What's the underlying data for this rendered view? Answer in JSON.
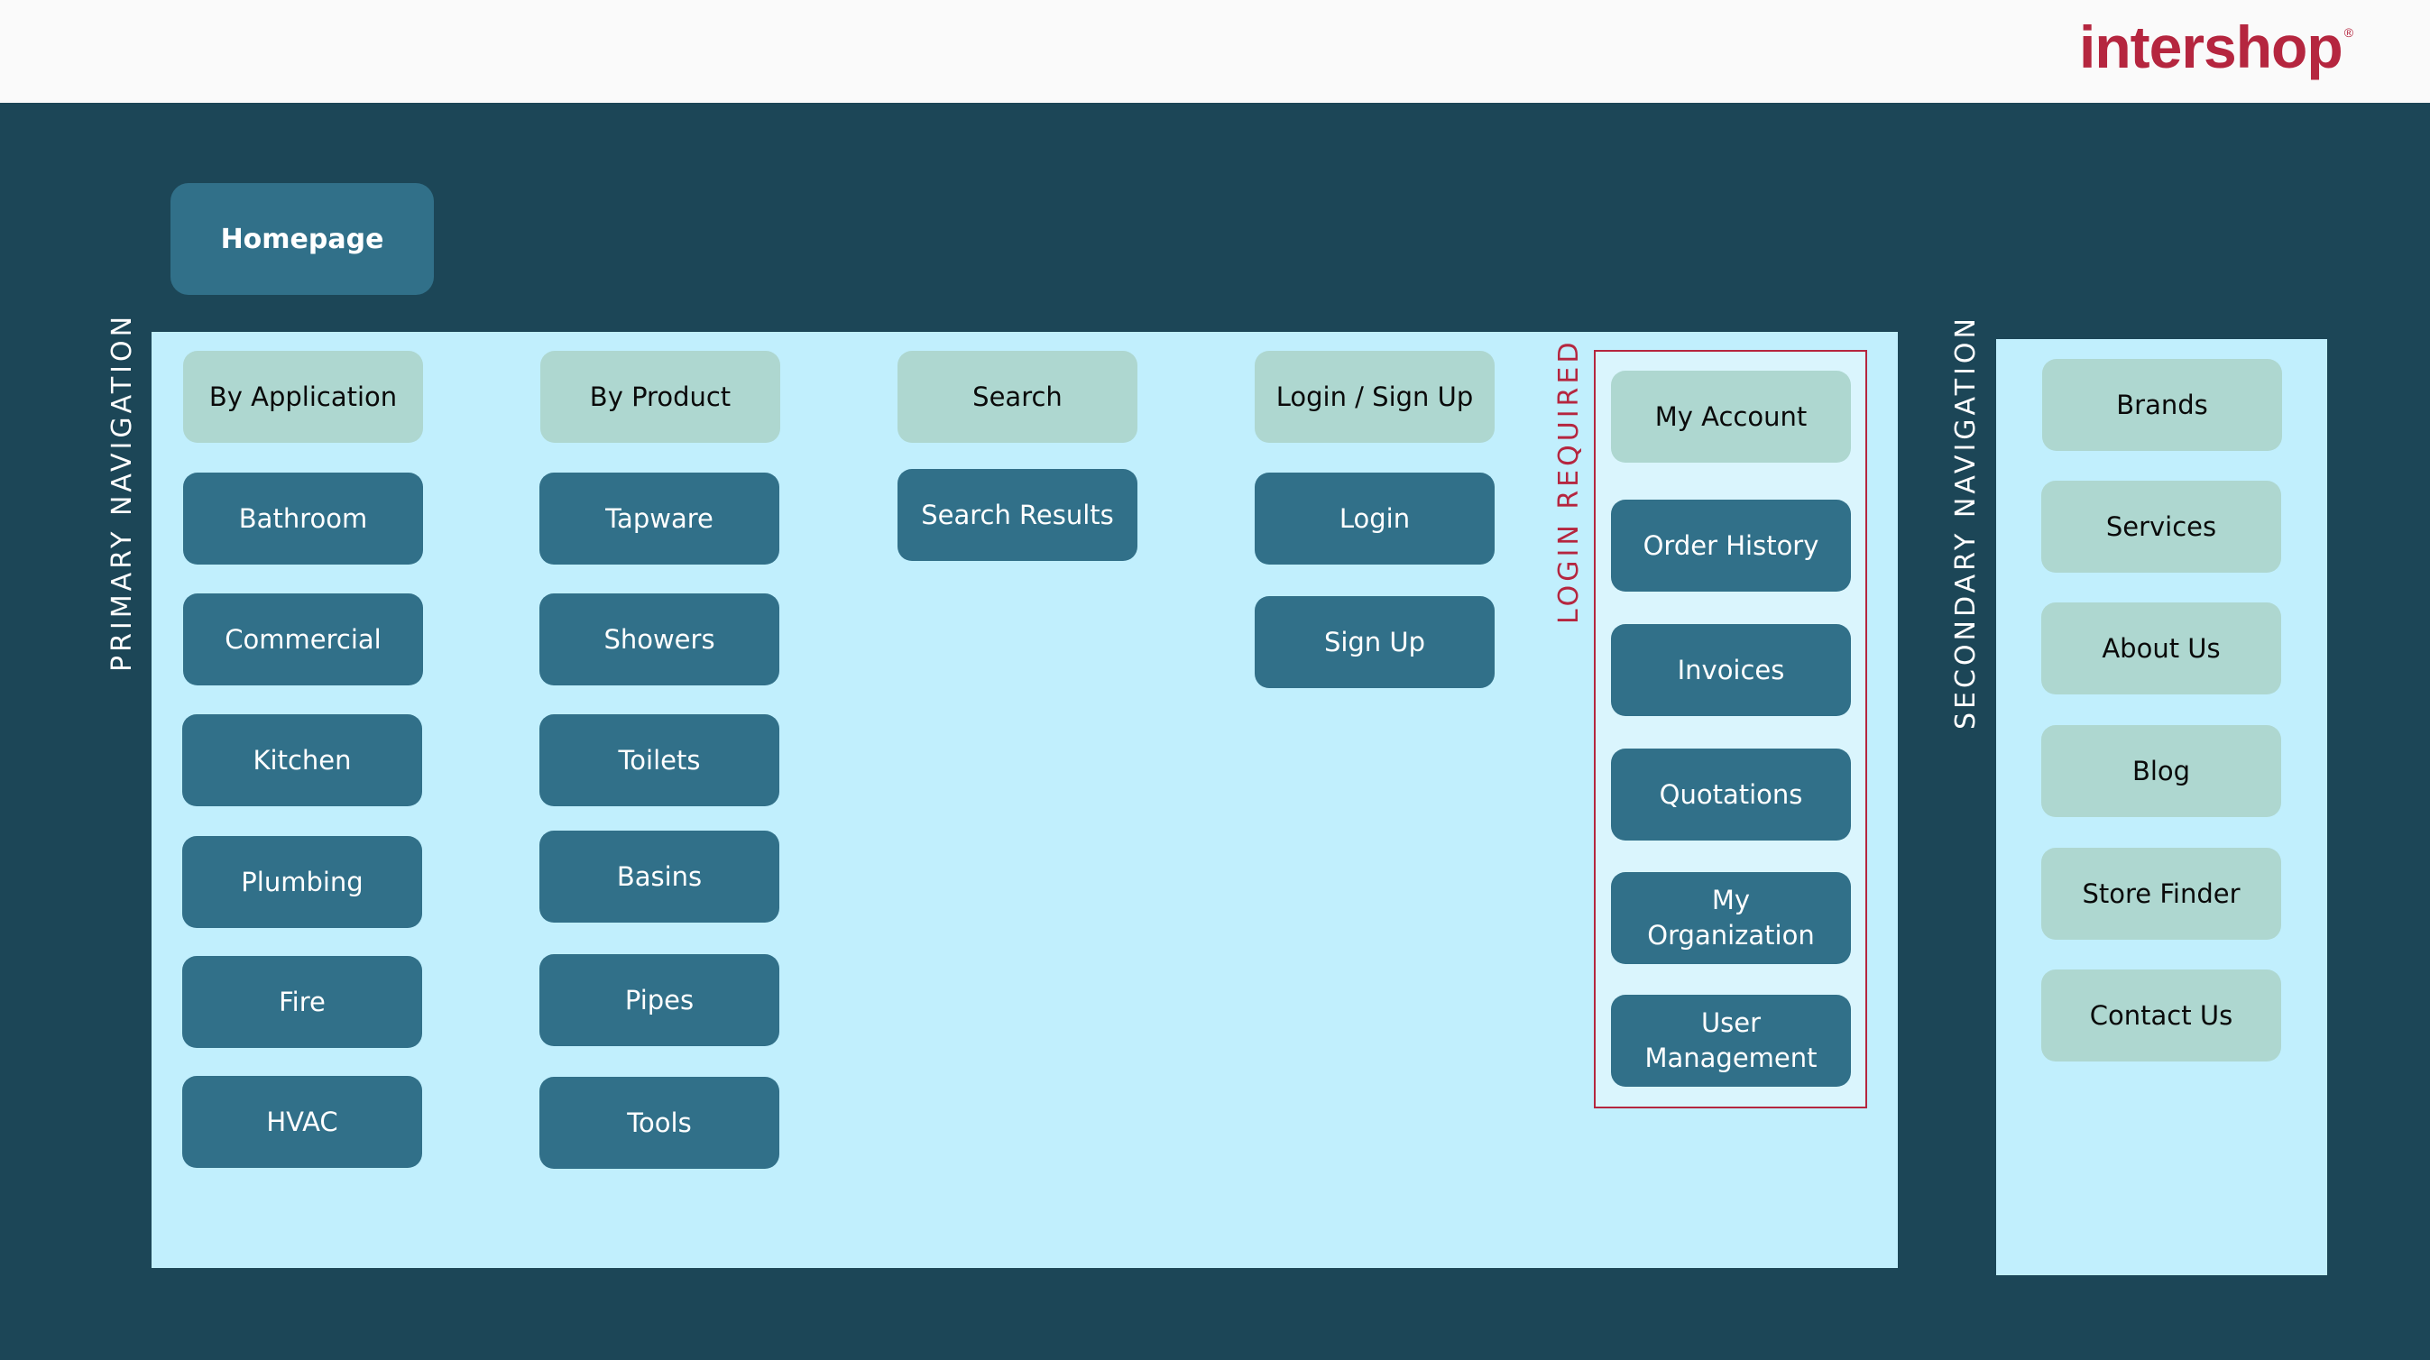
{
  "header": {
    "logo_text": "intershop",
    "logo_mark": "®",
    "brand_color": "#b5263f"
  },
  "colors": {
    "background": "#1c4657",
    "panel": "#c1effd",
    "dark_button": "#317089",
    "light_button": "#aed7d0",
    "login_box_fill": "#daf5fd",
    "login_box_border": "#b5263f"
  },
  "homepage": {
    "label": "Homepage"
  },
  "primary_navigation": {
    "label": "PRIMARY NAVIGATION",
    "columns": [
      {
        "header": "By Application",
        "items": [
          "Bathroom",
          "Commercial",
          "Kitchen",
          "Plumbing",
          "Fire",
          "HVAC"
        ]
      },
      {
        "header": "By Product",
        "items": [
          "Tapware",
          "Showers",
          "Toilets",
          "Basins",
          "Pipes",
          "Tools"
        ]
      },
      {
        "header": "Search",
        "items": [
          "Search Results"
        ]
      },
      {
        "header": "Login / Sign Up",
        "items": [
          "Login",
          "Sign Up"
        ]
      }
    ],
    "login_required": {
      "label": "LOGIN REQUIRED",
      "header": "My Account",
      "items": [
        "Order History",
        "Invoices",
        "Quotations",
        "My Organization",
        "User Management"
      ]
    }
  },
  "secondary_navigation": {
    "label": "SECONDARY NAVIGATION",
    "items": [
      "Brands",
      "Services",
      "About Us",
      "Blog",
      "Store Finder",
      "Contact Us"
    ]
  }
}
